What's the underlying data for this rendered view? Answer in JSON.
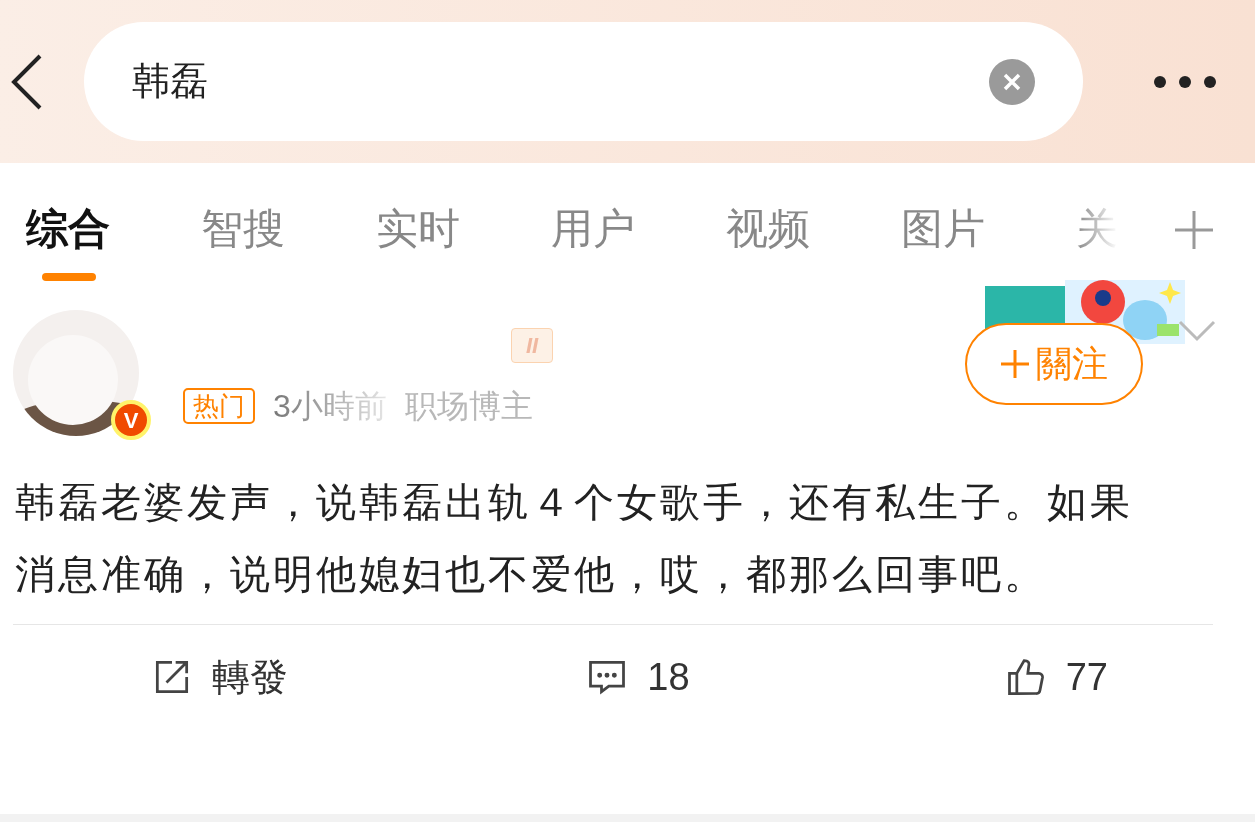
{
  "search": {
    "value": "韩磊"
  },
  "tabs": [
    {
      "label": "综合",
      "selected": true
    },
    {
      "label": "智搜",
      "selected": false
    },
    {
      "label": "实时",
      "selected": false
    },
    {
      "label": "用户",
      "selected": false
    },
    {
      "label": "视频",
      "selected": false
    },
    {
      "label": "图片",
      "selected": false
    },
    {
      "label": "关",
      "selected": false
    }
  ],
  "post": {
    "level_badge": "II",
    "verified_mark": "V",
    "hot_tag": "热门",
    "time": "3小時前",
    "category": "职场博主",
    "follow_label": "關注",
    "text": "韩磊老婆发声，说韩磊出轨４个女歌手，还有私生子。如果消息准确，说明他媳妇也不爱他，哎，都那么回事吧。",
    "actions": [
      {
        "kind": "repost",
        "label": "轉發"
      },
      {
        "kind": "comment",
        "label": "18"
      },
      {
        "kind": "like",
        "label": "77"
      }
    ]
  }
}
